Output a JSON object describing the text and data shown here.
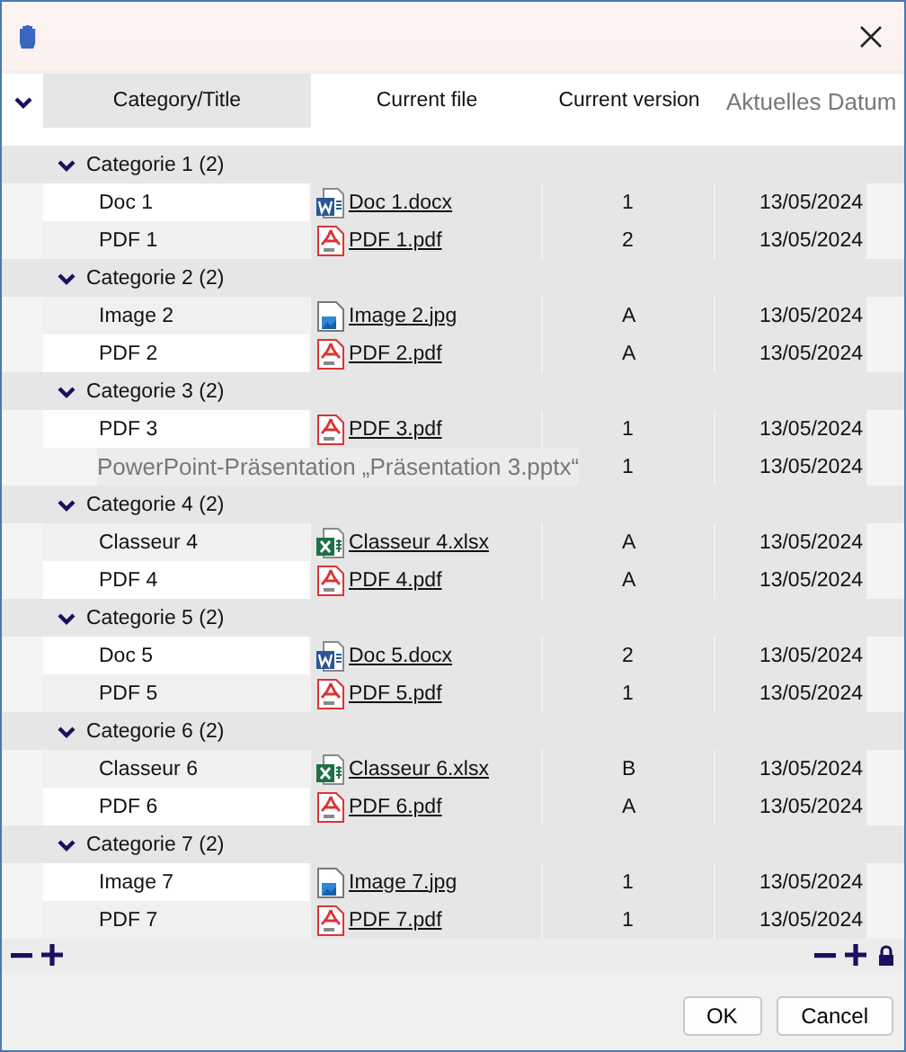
{
  "columns": [
    "Category/Title",
    "Current file",
    "Current version",
    "Aktuelles Datum"
  ],
  "groups": [
    {
      "label": "Categorie 1 (2)",
      "expanded": true,
      "items": [
        {
          "kind": "word",
          "title": "Doc 1",
          "file": "Doc 1.docx",
          "version": "1",
          "date": "13/05/2024"
        },
        {
          "kind": "pdf",
          "title": "PDF 1",
          "file": "PDF 1.pdf",
          "version": "2",
          "date": "13/05/2024"
        }
      ]
    },
    {
      "label": "Categorie 2 (2)",
      "expanded": true,
      "items": [
        {
          "kind": "image",
          "title": "Image 2",
          "file": "Image 2.jpg",
          "version": "A",
          "date": "13/05/2024"
        },
        {
          "kind": "pdf",
          "title": "PDF 2",
          "file": "PDF 2.pdf",
          "version": "A",
          "date": "13/05/2024"
        }
      ]
    },
    {
      "label": "Categorie 3 (2)",
      "expanded": true,
      "items": [
        {
          "kind": "pdf",
          "title": "PDF 3",
          "file": "PDF 3.pdf",
          "version": "1",
          "date": "13/05/2024"
        },
        {
          "kind": "drag_ghost",
          "tooltip": "PowerPoint-Präsentation „Präsentation 3.pptx“",
          "version": "1",
          "date": "13/05/2024"
        }
      ]
    },
    {
      "label": "Categorie 4 (2)",
      "expanded": true,
      "items": [
        {
          "kind": "excel",
          "title": "Classeur 4",
          "file": "Classeur 4.xlsx",
          "version": "A",
          "date": "13/05/2024"
        },
        {
          "kind": "pdf",
          "title": "PDF 4",
          "file": "PDF 4.pdf",
          "version": "A",
          "date": "13/05/2024"
        }
      ]
    },
    {
      "label": "Categorie 5 (2)",
      "expanded": true,
      "items": [
        {
          "kind": "word",
          "title": "Doc 5",
          "file": "Doc 5.docx",
          "version": "2",
          "date": "13/05/2024"
        },
        {
          "kind": "pdf",
          "title": "PDF 5",
          "file": "PDF 5.pdf",
          "version": "1",
          "date": "13/05/2024"
        }
      ]
    },
    {
      "label": "Categorie 6 (2)",
      "expanded": true,
      "items": [
        {
          "kind": "excel",
          "title": "Classeur 6",
          "file": "Classeur 6.xlsx",
          "version": "B",
          "date": "13/05/2024"
        },
        {
          "kind": "pdf",
          "title": "PDF 6",
          "file": "PDF 6.pdf",
          "version": "A",
          "date": "13/05/2024"
        }
      ]
    },
    {
      "label": "Categorie 7 (2)",
      "expanded": true,
      "items": [
        {
          "kind": "image",
          "title": "Image 7",
          "file": "Image 7.jpg",
          "version": "1",
          "date": "13/05/2024"
        },
        {
          "kind": "pdf",
          "title": "PDF 7",
          "file": "PDF 7.pdf",
          "version": "1",
          "date": "13/05/2024"
        }
      ]
    }
  ],
  "buttons": [
    "OK",
    "Cancel"
  ]
}
